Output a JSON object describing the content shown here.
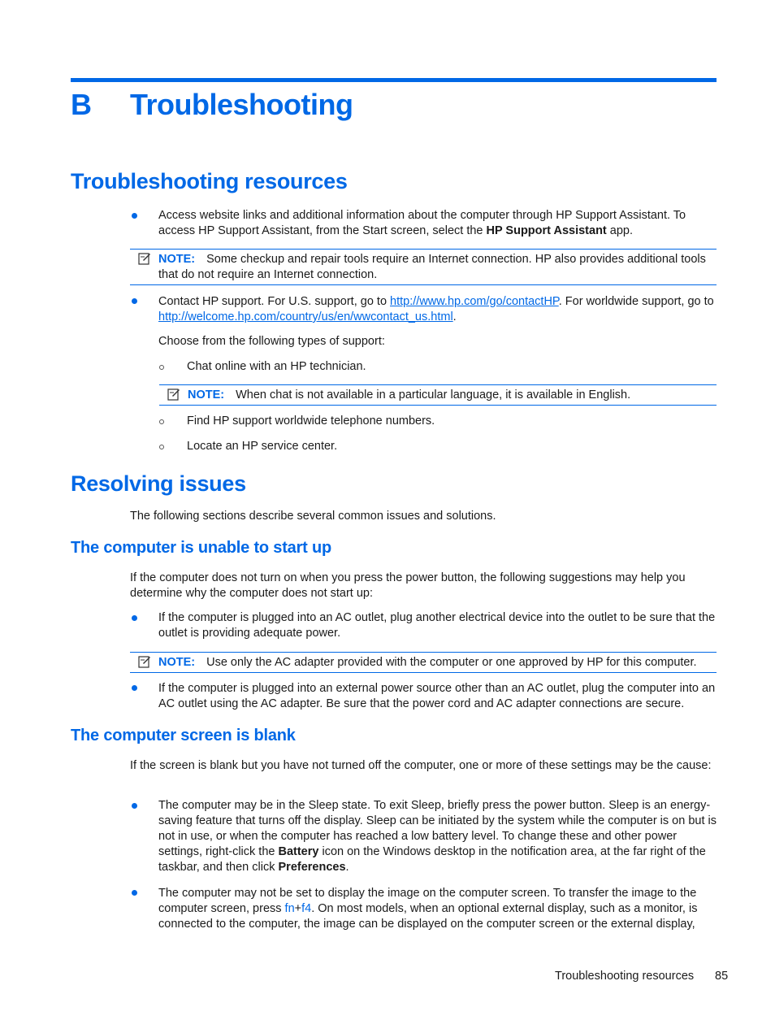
{
  "chapter": {
    "letter": "B",
    "title": "Troubleshooting"
  },
  "section1": {
    "title": "Troubleshooting resources",
    "bullet1": {
      "pre": "Access website links and additional information about the computer through HP Support Assistant. To access HP Support Assistant, from the Start screen, select the ",
      "bold": "HP Support Assistant",
      "post": " app."
    },
    "note1": {
      "label": "NOTE:",
      "text": "Some checkup and repair tools require an Internet connection. HP also provides additional tools that do not require an Internet connection."
    },
    "bullet2": {
      "pre": "Contact HP support. For U.S. support, go to ",
      "link1": "http://www.hp.com/go/contactHP",
      "mid": ". For worldwide support, go to ",
      "link2": "http://welcome.hp.com/country/us/en/wwcontact_us.html",
      "post": "."
    },
    "choose": "Choose from the following types of support:",
    "sub1": "Chat online with an HP technician.",
    "note2": {
      "label": "NOTE:",
      "text": "When chat is not available in a particular language, it is available in English."
    },
    "sub2": "Find HP support worldwide telephone numbers.",
    "sub3": "Locate an HP service center."
  },
  "section2": {
    "title": "Resolving issues",
    "intro": "The following sections describe several common issues and solutions.",
    "sub_a": {
      "title": "The computer is unable to start up",
      "intro": "If the computer does not turn on when you press the power button, the following suggestions may help you determine why the computer does not start up:",
      "bullet1": "If the computer is plugged into an AC outlet, plug another electrical device into the outlet to be sure that the outlet is providing adequate power.",
      "note": {
        "label": "NOTE:",
        "text": "Use only the AC adapter provided with the computer or one approved by HP for this computer."
      },
      "bullet2": "If the computer is plugged into an external power source other than an AC outlet, plug the computer into an AC outlet using the AC adapter. Be sure that the power cord and AC adapter connections are secure."
    },
    "sub_b": {
      "title": "The computer screen is blank",
      "intro": "If the screen is blank but you have not turned off the computer, one or more of these settings may be the cause:",
      "bullet1": {
        "pre": "The computer may be in the Sleep state. To exit Sleep, briefly press the power button. Sleep is an energy-saving feature that turns off the display. Sleep can be initiated by the system while the computer is on but is not in use, or when the computer has reached a low battery level. To change these and other power settings, right-click the ",
        "bold1": "Battery",
        "mid": " icon on the Windows desktop in the notification area, at the far right of the taskbar, and then click ",
        "bold2": "Preferences",
        "post": "."
      },
      "bullet2": {
        "pre": "The computer may not be set to display the image on the computer screen. To transfer the image to the computer screen, press ",
        "key1": "fn",
        "plus": "+",
        "key2": "f4",
        "post": ". On most models, when an optional external display, such as a monitor, is connected to the computer, the image can be displayed on the computer screen or the external display,"
      }
    }
  },
  "footer": {
    "section": "Troubleshooting resources",
    "page": "85"
  }
}
